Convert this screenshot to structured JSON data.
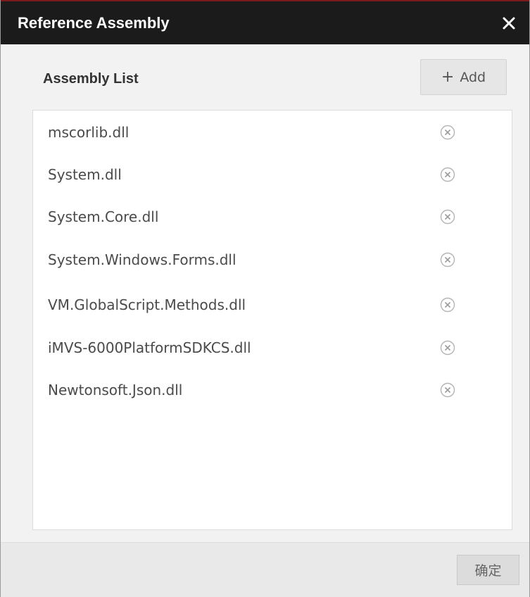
{
  "window": {
    "title": "Reference Assembly"
  },
  "assembly_list": {
    "heading": "Assembly List",
    "add_label": "Add",
    "items": [
      {
        "label": "mscorlib.dll"
      },
      {
        "label": "System.dll"
      },
      {
        "label": "System.Core.dll"
      },
      {
        "label": "System.Windows.Forms.dll"
      },
      {
        "label": "VM.GlobalScript.Methods.dll"
      },
      {
        "label": "iMVS-6000PlatformSDKCS.dll"
      },
      {
        "label": "Newtonsoft.Json.dll"
      }
    ]
  },
  "footer": {
    "ok_label": "确定"
  },
  "icons": {
    "close": "close-icon",
    "add": "plus-icon",
    "remove": "remove-circle-x-icon"
  },
  "colors": {
    "titlebar_bg": "#1b1b1b",
    "titlebar_accent": "#7a1a1a",
    "dialog_bg": "#f2f2f2",
    "list_bg": "#ffffff",
    "footer_bg": "#e9e9e9"
  }
}
